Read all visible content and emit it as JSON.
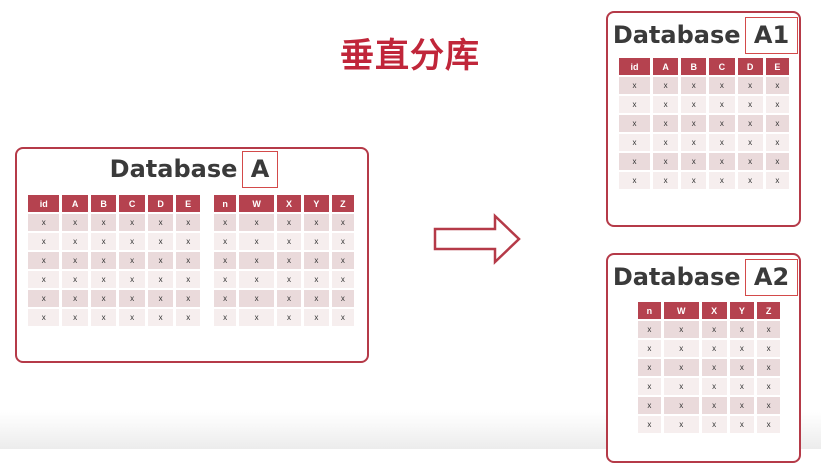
{
  "headline": "垂直分库",
  "database_a": {
    "title_prefix": "Database ",
    "title_suffix": "A",
    "table1": {
      "headers": [
        "id",
        "A",
        "B",
        "C",
        "D",
        "E"
      ],
      "rows": [
        [
          "x",
          "x",
          "x",
          "x",
          "x",
          "x"
        ],
        [
          "x",
          "x",
          "x",
          "x",
          "x",
          "x"
        ],
        [
          "x",
          "x",
          "x",
          "x",
          "x",
          "x"
        ],
        [
          "x",
          "x",
          "x",
          "x",
          "x",
          "x"
        ],
        [
          "x",
          "x",
          "x",
          "x",
          "x",
          "x"
        ],
        [
          "x",
          "x",
          "x",
          "x",
          "x",
          "x"
        ]
      ]
    },
    "table2": {
      "headers": [
        "n",
        "W",
        "X",
        "Y",
        "Z"
      ],
      "rows": [
        [
          "x",
          "x",
          "x",
          "x",
          "x"
        ],
        [
          "x",
          "x",
          "x",
          "x",
          "x"
        ],
        [
          "x",
          "x",
          "x",
          "x",
          "x"
        ],
        [
          "x",
          "x",
          "x",
          "x",
          "x"
        ],
        [
          "x",
          "x",
          "x",
          "x",
          "x"
        ],
        [
          "x",
          "x",
          "x",
          "x",
          "x"
        ]
      ]
    }
  },
  "database_a1": {
    "title_prefix": "Database ",
    "title_suffix": "A1",
    "table": {
      "headers": [
        "id",
        "A",
        "B",
        "C",
        "D",
        "E"
      ],
      "rows": [
        [
          "x",
          "x",
          "x",
          "x",
          "x",
          "x"
        ],
        [
          "x",
          "x",
          "x",
          "x",
          "x",
          "x"
        ],
        [
          "x",
          "x",
          "x",
          "x",
          "x",
          "x"
        ],
        [
          "x",
          "x",
          "x",
          "x",
          "x",
          "x"
        ],
        [
          "x",
          "x",
          "x",
          "x",
          "x",
          "x"
        ],
        [
          "x",
          "x",
          "x",
          "x",
          "x",
          "x"
        ]
      ]
    }
  },
  "database_a2": {
    "title_prefix": "Database ",
    "title_suffix": "A2",
    "table": {
      "headers": [
        "n",
        "W",
        "X",
        "Y",
        "Z"
      ],
      "rows": [
        [
          "x",
          "x",
          "x",
          "x",
          "x"
        ],
        [
          "x",
          "x",
          "x",
          "x",
          "x"
        ],
        [
          "x",
          "x",
          "x",
          "x",
          "x"
        ],
        [
          "x",
          "x",
          "x",
          "x",
          "x"
        ],
        [
          "x",
          "x",
          "x",
          "x",
          "x"
        ],
        [
          "x",
          "x",
          "x",
          "x",
          "x"
        ]
      ]
    }
  },
  "colors": {
    "accent": "#b53a48",
    "header_fill": "#b5424f",
    "headline": "#c0263a",
    "row_dark": "#eadadb",
    "row_light": "#f6eeee"
  }
}
